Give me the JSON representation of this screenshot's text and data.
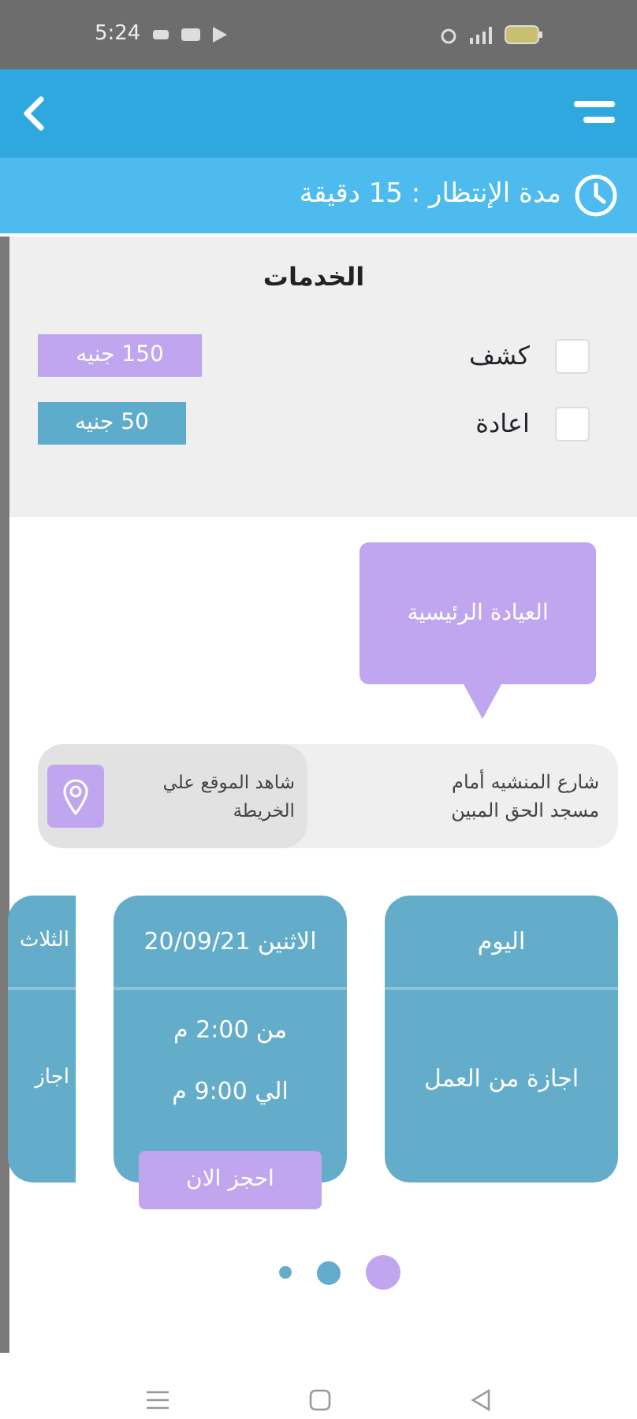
{
  "status_bar": {
    "time": "5:24"
  },
  "wait_bar": {
    "text": "مدة الإنتظار : 15 دقيقة"
  },
  "services": {
    "title": "الخدمات",
    "items": [
      {
        "label": "كشف",
        "price": "150 جنيه",
        "checked": false,
        "color": "#c0a6ee"
      },
      {
        "label": "اعادة",
        "price": "50 جنيه",
        "checked": false,
        "color": "#5eaccb"
      }
    ]
  },
  "clinic": {
    "name": "العيادة الرئيسية",
    "address": "شارع المنشيه أمام مسجد الحق المبين",
    "map_link": "شاهد الموقع علي الخريطة"
  },
  "schedule": [
    {
      "kind": "off",
      "day": "اليوم",
      "note": "اجازة من العمل"
    },
    {
      "kind": "open",
      "day": "الاثنين 20/09/21",
      "from": "من 2:00 م",
      "to": "الي 9:00 م",
      "action": "احجز الان"
    },
    {
      "kind": "partial",
      "day": "الثلاث",
      "note": "اجاز"
    }
  ],
  "pager": [
    {
      "selected": true
    },
    {
      "selected": false
    },
    {
      "selected": false
    }
  ]
}
